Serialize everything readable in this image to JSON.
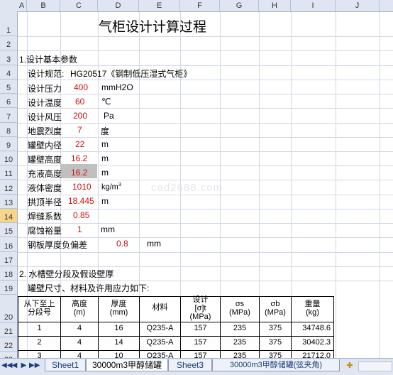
{
  "columns": [
    "A",
    "B",
    "C",
    "D",
    "E",
    "F",
    "G",
    "H",
    "I",
    "J"
  ],
  "rows": [
    "1",
    "2",
    "3",
    "4",
    "5",
    "6",
    "7",
    "8",
    "9",
    "10",
    "11",
    "12",
    "13",
    "14",
    "15",
    "16",
    "17",
    "18",
    "19",
    "20",
    "21",
    "22",
    "23"
  ],
  "selected_row": "14",
  "title": "气柜设计计算过程",
  "section1": "1.设计基本参数",
  "params": {
    "spec_label": "设计规范:",
    "spec_value": "HG20517《钢制低压湿式气柜》",
    "pressure_label": "设计压力",
    "pressure_value": "400",
    "pressure_unit": "mmH2O",
    "temp_label": "设计温度",
    "temp_value": "60",
    "temp_unit": "℃",
    "wind_label": "设计风压",
    "wind_value": "200",
    "wind_unit": "Pa",
    "quake_label": "地震烈度",
    "quake_value": "7",
    "quake_unit": "度",
    "diam_label": "罐壁内径",
    "diam_value": "22",
    "diam_unit": "m",
    "height_label": "罐壁高度",
    "height_value": "16.2",
    "height_unit": "m",
    "fill_label": "充液高度",
    "fill_value": "16.2",
    "fill_unit": "m",
    "density_label": "液体密度",
    "density_value": "1010",
    "density_unit": "kg/m",
    "density_sup": "3",
    "radius_label": "拱顶半径",
    "radius_value": "18.445",
    "radius_unit": "m",
    "weld_label": "焊缝系数",
    "weld_value": "0.85",
    "corr_label": "腐蚀裕量",
    "corr_value": "1",
    "corr_unit": "mm",
    "neg_label": "钢板厚度负偏差",
    "neg_value": "0.8",
    "neg_unit": "mm"
  },
  "section2": "2. 水槽壁分段及假设壁厚",
  "section2_sub": "罐壁尺寸、材料及许用应力如下:",
  "table": {
    "headers": [
      [
        "从下至上",
        "分段号"
      ],
      [
        "高度",
        "(m)"
      ],
      [
        "厚度",
        "(mm)"
      ],
      [
        "材料",
        ""
      ],
      [
        "设计",
        "[σ]t",
        "(MPa)"
      ],
      [
        "σs",
        "(MPa)"
      ],
      [
        "σb",
        "(MPa)"
      ],
      [
        "重量",
        "(kg)"
      ]
    ],
    "rows": [
      [
        "1",
        "4",
        "16",
        "Q235-A",
        "157",
        "235",
        "375",
        "34748.6"
      ],
      [
        "2",
        "4",
        "14",
        "Q235-A",
        "157",
        "235",
        "375",
        "30402.3"
      ],
      [
        "3",
        "4",
        "10",
        "Q235-A",
        "157",
        "235",
        "375",
        "21712.0"
      ]
    ]
  },
  "watermark": "cad2688.com",
  "tabs": [
    "Sheet1",
    "30000m3甲醇储罐",
    "Sheet3",
    "30000m3甲醇储罐(弦夹角)"
  ],
  "active_tab": 1,
  "nav": [
    "◀◀",
    "◀",
    "▶",
    "▶▶"
  ]
}
